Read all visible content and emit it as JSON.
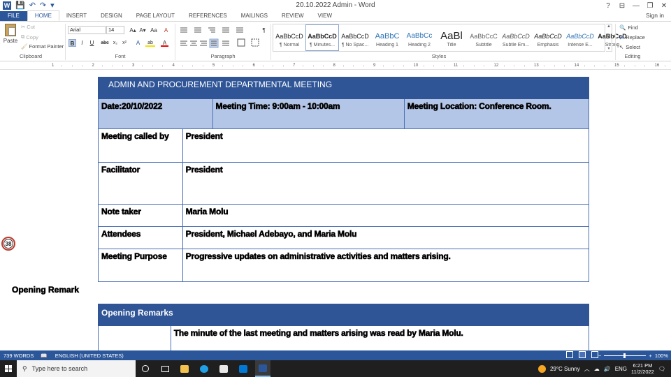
{
  "titlebar": {
    "title": "20.10.2022 Admin - Word",
    "qat": {
      "save": "💾",
      "undo": "↶",
      "redo": "↷",
      "more": "▾",
      "word_logo": "W"
    },
    "controls": {
      "help": "?",
      "ribbon_opts": "⊟",
      "minimize": "—",
      "restore": "❐",
      "close": "✕"
    }
  },
  "tabs": {
    "file": "FILE",
    "items": [
      "HOME",
      "INSERT",
      "DESIGN",
      "PAGE LAYOUT",
      "REFERENCES",
      "MAILINGS",
      "REVIEW",
      "VIEW"
    ],
    "signin": "Sign in"
  },
  "ribbon": {
    "clipboard": {
      "paste": "Paste",
      "cut": "Cut",
      "copy": "Copy",
      "format_painter": "Format Painter",
      "label": "Clipboard"
    },
    "font": {
      "name": "Arial",
      "size": "14",
      "label": "Font",
      "bold": "B",
      "italic": "I",
      "underline": "U",
      "strike": "abc",
      "sub": "x₂",
      "sup": "x²",
      "grow": "A▴",
      "shrink": "A▾",
      "case": "Aa",
      "clear": "A",
      "effects": "A",
      "highlight": "ab",
      "color": "A"
    },
    "paragraph": {
      "label": "Paragraph",
      "show_marks": "¶"
    },
    "styles": {
      "label": "Styles",
      "items": [
        {
          "sample": "AaBbCcD",
          "name": "¶ Normal"
        },
        {
          "sample": "AaBbCcD",
          "name": "¶ Minutes..."
        },
        {
          "sample": "AaBbCcD",
          "name": "¶ No Spac..."
        },
        {
          "sample": "AaBbC",
          "name": "Heading 1"
        },
        {
          "sample": "AaBbCc",
          "name": "Heading 2"
        },
        {
          "sample": "AaBl",
          "name": "Title"
        },
        {
          "sample": "AaBbCcC",
          "name": "Subtitle"
        },
        {
          "sample": "AaBbCcD",
          "name": "Subtle Em..."
        },
        {
          "sample": "AaBbCcD",
          "name": "Emphasis"
        },
        {
          "sample": "AaBbCcD",
          "name": "Intense E..."
        },
        {
          "sample": "AaBbCcD",
          "name": "Strong"
        }
      ]
    },
    "editing": {
      "label": "Editing",
      "find": "Find",
      "replace": "Replace",
      "select": "Select"
    }
  },
  "ruler": {
    "numbers": [
      "1",
      "2",
      "3",
      "4",
      "5",
      "6",
      "7",
      "8",
      "9",
      "10",
      "11",
      "12",
      "13",
      "14",
      "15",
      "16"
    ]
  },
  "document": {
    "header_title": "ADMIN AND PROCUREMENT DEPARTMENTAL MEETING",
    "date": "Date:20/10/2022",
    "meeting_time": "Meeting Time:  9:00am - 10:00am",
    "meeting_location": "Meeting Location: Conference Room.",
    "rows": [
      {
        "label": "Meeting called by",
        "value": "President"
      },
      {
        "label": "Facilitator",
        "value": "President"
      },
      {
        "label": "Note taker",
        "value": "Maria Molu"
      },
      {
        "label": "Attendees",
        "value": "President, Michael Adebayo, and Maria Molu"
      },
      {
        "label": "Meeting Purpose",
        "value": "Progressive updates on administrative activities and matters arising."
      }
    ],
    "margin_badge": "38",
    "opening_remark_heading": "Opening Remark",
    "opening_remarks_bar": "Opening Remarks",
    "minutes_text": "The minute of the last meeting and matters arising was read by Maria Molu."
  },
  "statusbar": {
    "words": "739 WORDS",
    "language": "ENGLISH (UNITED STATES)",
    "zoom": "100%",
    "zoom_out": "−",
    "zoom_in": "+"
  },
  "taskbar": {
    "search_placeholder": "Type here to search",
    "weather": "29°C  Sunny",
    "lang": "ENG",
    "time": "6:21 PM",
    "date": "11/2/2022",
    "chevron": "︿"
  },
  "colors": {
    "word_blue": "#2b579a",
    "table_header": "#2f5597",
    "table_light": "#b4c6e7",
    "taskbar": "#1f1f1f"
  }
}
